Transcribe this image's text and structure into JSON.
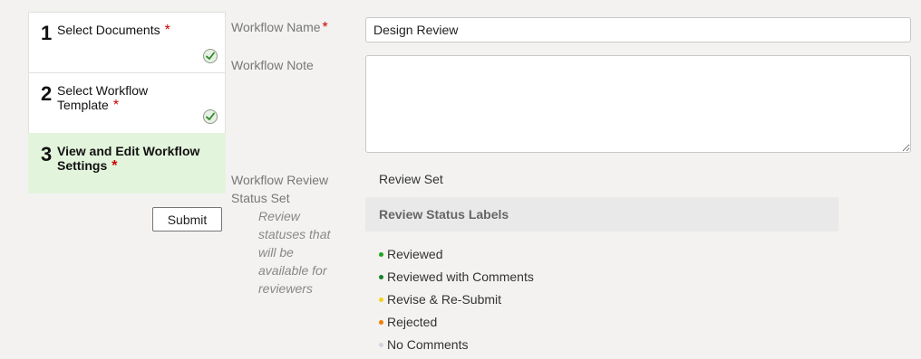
{
  "steps": [
    {
      "number": "1",
      "title": "Select Documents",
      "required": "*",
      "completed": true
    },
    {
      "number": "2",
      "title": "Select Workflow Template",
      "required": "*",
      "completed": true
    },
    {
      "number": "3",
      "title": "View and Edit Workflow Settings",
      "required": "*",
      "completed": false
    }
  ],
  "submit_label": "Submit",
  "form": {
    "workflow_name_label": "Workflow Name",
    "required_marker": "*",
    "workflow_name_value": "Design Review",
    "workflow_note_label": "Workflow Note",
    "workflow_note_value": "",
    "review_status_set_label": "Workflow Review Status Set",
    "review_status_help": "Review statuses that will be available for reviewers",
    "review_set_value": "Review Set",
    "status_labels_header": "Review Status Labels",
    "statuses": [
      {
        "label": "Reviewed",
        "color": "#1fa51f"
      },
      {
        "label": "Reviewed with Comments",
        "color": "#17802a"
      },
      {
        "label": "Revise & Re-Submit",
        "color": "#f3d21c"
      },
      {
        "label": "Rejected",
        "color": "#f07f00"
      },
      {
        "label": "No Comments",
        "color": "#d4d4dc"
      }
    ]
  },
  "icons": {
    "step_complete": "check-circle-icon"
  }
}
